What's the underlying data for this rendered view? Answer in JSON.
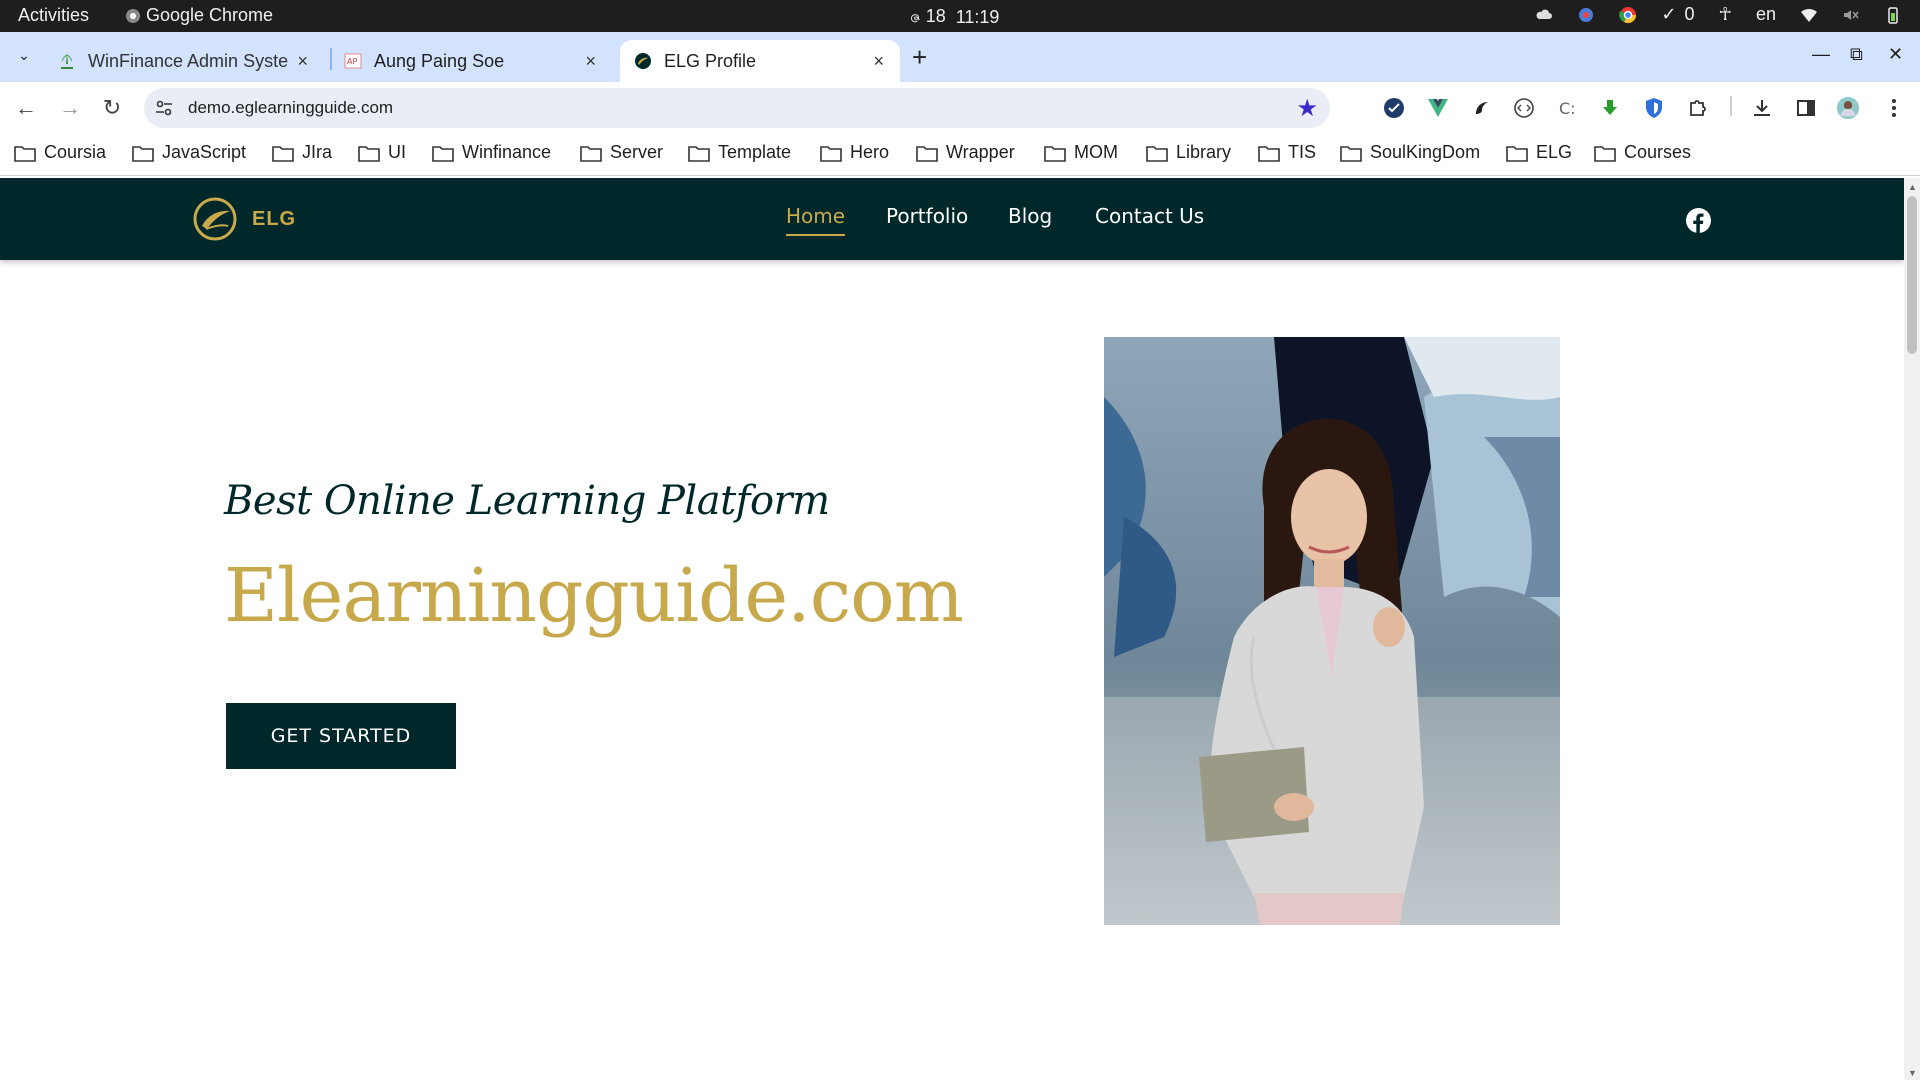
{
  "os": {
    "activities": "Activities",
    "app_name": "Google Chrome",
    "clock_prefix": "ဇ 18",
    "time": "11:19",
    "check_count": "0",
    "language": "en"
  },
  "browser": {
    "tabs": [
      {
        "title": "WinFinance Admin Syste",
        "close": "×"
      },
      {
        "title": "Aung Paing Soe",
        "close": "×"
      },
      {
        "title": "ELG Profile",
        "close": "×"
      }
    ],
    "new_tab": "+",
    "url": "demo.eglearningguide.com",
    "bookmarks": [
      "Coursia",
      "JavaScript",
      "JIra",
      "UI",
      "Winfinance",
      "Server",
      "Template",
      "Hero",
      "Wrapper",
      "MOM",
      "Library",
      "TIS",
      "SoulKingDom",
      "ELG",
      "Courses"
    ],
    "accent": "#d3e3fd"
  },
  "site": {
    "logo_text": "ELG",
    "nav": [
      "Home",
      "Portfolio",
      "Blog",
      "Contact Us"
    ],
    "hero_script": "Best Online Learning Platform",
    "hero_title": "Elearningguide.com",
    "cta": "GET STARTED",
    "colors": {
      "primary": "#00282b",
      "gold": "#c7a84a"
    }
  }
}
